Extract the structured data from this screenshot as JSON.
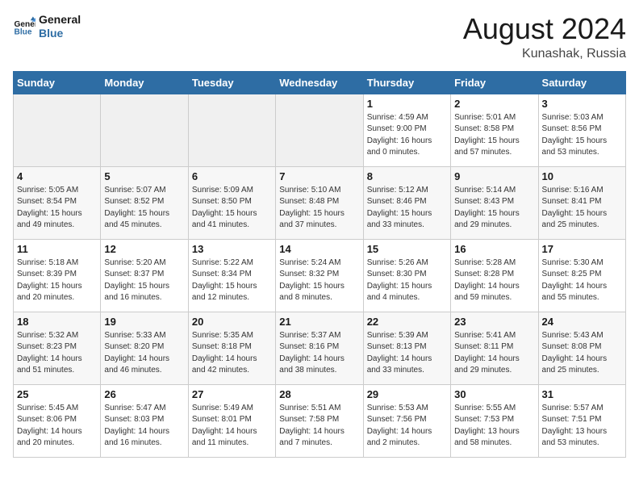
{
  "header": {
    "logo_line1": "General",
    "logo_line2": "Blue",
    "month_year": "August 2024",
    "location": "Kunashak, Russia"
  },
  "days_of_week": [
    "Sunday",
    "Monday",
    "Tuesday",
    "Wednesday",
    "Thursday",
    "Friday",
    "Saturday"
  ],
  "weeks": [
    [
      {
        "day": "",
        "info": ""
      },
      {
        "day": "",
        "info": ""
      },
      {
        "day": "",
        "info": ""
      },
      {
        "day": "",
        "info": ""
      },
      {
        "day": "1",
        "info": "Sunrise: 4:59 AM\nSunset: 9:00 PM\nDaylight: 16 hours\nand 0 minutes."
      },
      {
        "day": "2",
        "info": "Sunrise: 5:01 AM\nSunset: 8:58 PM\nDaylight: 15 hours\nand 57 minutes."
      },
      {
        "day": "3",
        "info": "Sunrise: 5:03 AM\nSunset: 8:56 PM\nDaylight: 15 hours\nand 53 minutes."
      }
    ],
    [
      {
        "day": "4",
        "info": "Sunrise: 5:05 AM\nSunset: 8:54 PM\nDaylight: 15 hours\nand 49 minutes."
      },
      {
        "day": "5",
        "info": "Sunrise: 5:07 AM\nSunset: 8:52 PM\nDaylight: 15 hours\nand 45 minutes."
      },
      {
        "day": "6",
        "info": "Sunrise: 5:09 AM\nSunset: 8:50 PM\nDaylight: 15 hours\nand 41 minutes."
      },
      {
        "day": "7",
        "info": "Sunrise: 5:10 AM\nSunset: 8:48 PM\nDaylight: 15 hours\nand 37 minutes."
      },
      {
        "day": "8",
        "info": "Sunrise: 5:12 AM\nSunset: 8:46 PM\nDaylight: 15 hours\nand 33 minutes."
      },
      {
        "day": "9",
        "info": "Sunrise: 5:14 AM\nSunset: 8:43 PM\nDaylight: 15 hours\nand 29 minutes."
      },
      {
        "day": "10",
        "info": "Sunrise: 5:16 AM\nSunset: 8:41 PM\nDaylight: 15 hours\nand 25 minutes."
      }
    ],
    [
      {
        "day": "11",
        "info": "Sunrise: 5:18 AM\nSunset: 8:39 PM\nDaylight: 15 hours\nand 20 minutes."
      },
      {
        "day": "12",
        "info": "Sunrise: 5:20 AM\nSunset: 8:37 PM\nDaylight: 15 hours\nand 16 minutes."
      },
      {
        "day": "13",
        "info": "Sunrise: 5:22 AM\nSunset: 8:34 PM\nDaylight: 15 hours\nand 12 minutes."
      },
      {
        "day": "14",
        "info": "Sunrise: 5:24 AM\nSunset: 8:32 PM\nDaylight: 15 hours\nand 8 minutes."
      },
      {
        "day": "15",
        "info": "Sunrise: 5:26 AM\nSunset: 8:30 PM\nDaylight: 15 hours\nand 4 minutes."
      },
      {
        "day": "16",
        "info": "Sunrise: 5:28 AM\nSunset: 8:28 PM\nDaylight: 14 hours\nand 59 minutes."
      },
      {
        "day": "17",
        "info": "Sunrise: 5:30 AM\nSunset: 8:25 PM\nDaylight: 14 hours\nand 55 minutes."
      }
    ],
    [
      {
        "day": "18",
        "info": "Sunrise: 5:32 AM\nSunset: 8:23 PM\nDaylight: 14 hours\nand 51 minutes."
      },
      {
        "day": "19",
        "info": "Sunrise: 5:33 AM\nSunset: 8:20 PM\nDaylight: 14 hours\nand 46 minutes."
      },
      {
        "day": "20",
        "info": "Sunrise: 5:35 AM\nSunset: 8:18 PM\nDaylight: 14 hours\nand 42 minutes."
      },
      {
        "day": "21",
        "info": "Sunrise: 5:37 AM\nSunset: 8:16 PM\nDaylight: 14 hours\nand 38 minutes."
      },
      {
        "day": "22",
        "info": "Sunrise: 5:39 AM\nSunset: 8:13 PM\nDaylight: 14 hours\nand 33 minutes."
      },
      {
        "day": "23",
        "info": "Sunrise: 5:41 AM\nSunset: 8:11 PM\nDaylight: 14 hours\nand 29 minutes."
      },
      {
        "day": "24",
        "info": "Sunrise: 5:43 AM\nSunset: 8:08 PM\nDaylight: 14 hours\nand 25 minutes."
      }
    ],
    [
      {
        "day": "25",
        "info": "Sunrise: 5:45 AM\nSunset: 8:06 PM\nDaylight: 14 hours\nand 20 minutes."
      },
      {
        "day": "26",
        "info": "Sunrise: 5:47 AM\nSunset: 8:03 PM\nDaylight: 14 hours\nand 16 minutes."
      },
      {
        "day": "27",
        "info": "Sunrise: 5:49 AM\nSunset: 8:01 PM\nDaylight: 14 hours\nand 11 minutes."
      },
      {
        "day": "28",
        "info": "Sunrise: 5:51 AM\nSunset: 7:58 PM\nDaylight: 14 hours\nand 7 minutes."
      },
      {
        "day": "29",
        "info": "Sunrise: 5:53 AM\nSunset: 7:56 PM\nDaylight: 14 hours\nand 2 minutes."
      },
      {
        "day": "30",
        "info": "Sunrise: 5:55 AM\nSunset: 7:53 PM\nDaylight: 13 hours\nand 58 minutes."
      },
      {
        "day": "31",
        "info": "Sunrise: 5:57 AM\nSunset: 7:51 PM\nDaylight: 13 hours\nand 53 minutes."
      }
    ]
  ]
}
